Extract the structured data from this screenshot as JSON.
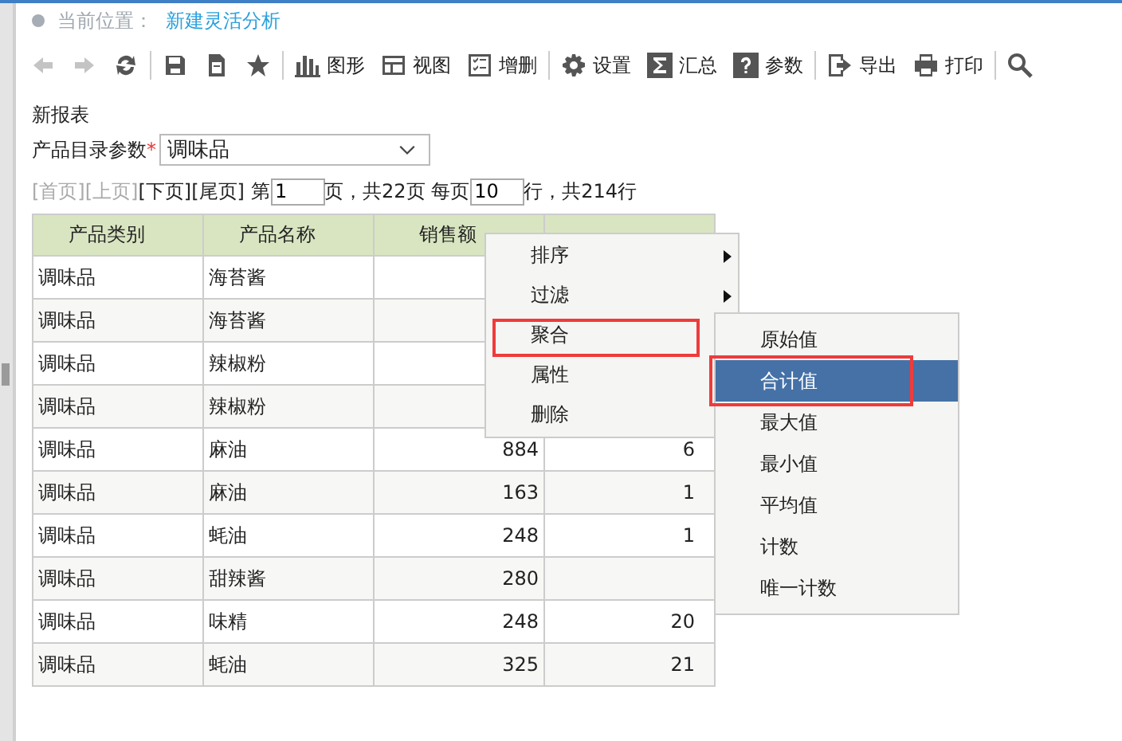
{
  "breadcrumb": {
    "label": "当前位置：",
    "current": "新建灵活分析"
  },
  "toolbar": [
    {
      "disabled": true
    },
    {
      "disabled": true
    },
    {
      "disabled": false
    },
    {
      "disabled": false
    },
    {
      "disabled": false
    },
    {
      "disabled": false
    },
    {
      "label": "图形",
      "disabled": false
    },
    {
      "label": "视图",
      "disabled": false
    },
    {
      "label": "增删",
      "disabled": false
    },
    {
      "label": "设置",
      "disabled": false
    },
    {
      "label": "汇总",
      "disabled": false
    },
    {
      "label": "参数",
      "disabled": false
    },
    {
      "label": "导出",
      "disabled": false
    },
    {
      "label": "打印",
      "disabled": false
    },
    {
      "disabled": false
    }
  ],
  "report_title": "新报表",
  "parameter": {
    "label": "产品目录参数",
    "required_mark": "*",
    "value": "调味品"
  },
  "pager": {
    "links": [
      {
        "label": "[首页]",
        "disabled": true
      },
      {
        "label": "[上页]",
        "disabled": true
      },
      {
        "label": "[下页]",
        "disabled": false
      },
      {
        "label": "[尾页]",
        "disabled": false
      }
    ],
    "page_prefix": "第",
    "page": "1",
    "page_suffix": "页，共22页 每页",
    "rows_per_page": "10",
    "rows_suffix": "行，共214行"
  },
  "table": {
    "columns": [
      "产品类别",
      "产品名称",
      "销售额"
    ],
    "rows": [
      [
        "调味品",
        "海苔酱"
      ],
      [
        "调味品",
        "海苔酱"
      ],
      [
        "调味品",
        "辣椒粉"
      ],
      [
        "调味品",
        "辣椒粉"
      ],
      [
        "调味品",
        "麻油",
        "884",
        "6"
      ],
      [
        "调味品",
        "麻油",
        "163",
        "1"
      ],
      [
        "调味品",
        "蚝油",
        "248",
        "1"
      ],
      [
        "调味品",
        "甜辣酱",
        "280"
      ],
      [
        "调味品",
        "味精",
        "248",
        "20"
      ],
      [
        "调味品",
        "蚝油",
        "325",
        "21"
      ]
    ]
  },
  "context_menu": {
    "items": [
      {
        "label": "排序",
        "submenu": true,
        "annotated": false
      },
      {
        "label": "过滤",
        "submenu": true,
        "annotated": false
      },
      {
        "label": "聚合",
        "submenu": false,
        "annotated": true
      },
      {
        "label": "属性",
        "submenu": false,
        "annotated": false
      },
      {
        "label": "删除",
        "submenu": false,
        "annotated": false
      }
    ]
  },
  "submenu": {
    "items": [
      {
        "label": "原始值",
        "selected": false,
        "annotated": false
      },
      {
        "label": "合计值",
        "selected": true,
        "annotated": true
      },
      {
        "label": "最大值",
        "selected": false,
        "annotated": false
      },
      {
        "label": "最小值",
        "selected": false,
        "annotated": false
      },
      {
        "label": "平均值",
        "selected": false,
        "annotated": false
      },
      {
        "label": "计数",
        "selected": false,
        "annotated": false
      },
      {
        "label": "唯一计数",
        "selected": false,
        "annotated": false
      }
    ]
  }
}
